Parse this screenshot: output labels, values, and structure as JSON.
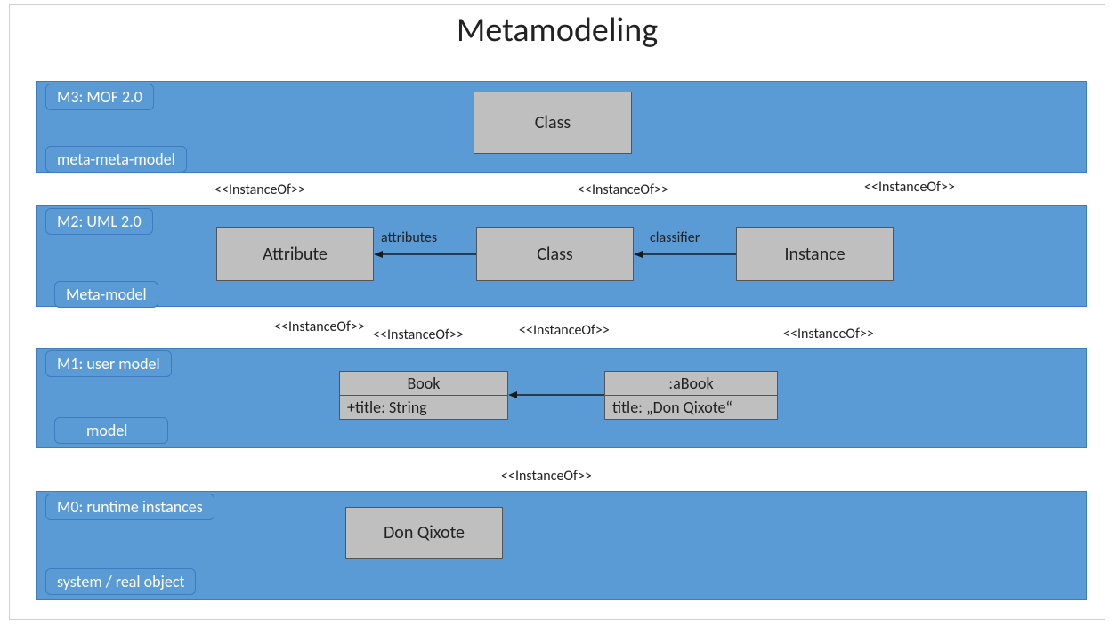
{
  "title": "Metamodeling",
  "stereotype": "<<InstanceOf>>",
  "layers": {
    "m3": {
      "name": "M3: MOF 2.0",
      "desc": "meta-meta-model"
    },
    "m2": {
      "name": "M2: UML 2.0",
      "desc": "Meta-model"
    },
    "m1": {
      "name": "M1: user model",
      "desc": "model"
    },
    "m0": {
      "name": "M0: runtime instances",
      "desc": "system / real object"
    }
  },
  "boxes": {
    "m3_class": "Class",
    "m2_attribute": "Attribute",
    "m2_class": "Class",
    "m2_instance": "Instance",
    "m1_book_title": "Book",
    "m1_book_attr": "+title: String",
    "m1_abook_title": ":aBook",
    "m1_abook_attr": "title: „Don Qixote“",
    "m0_obj": "Don Qixote"
  },
  "arrows": {
    "attributes": "attributes",
    "classifier": "classifier"
  }
}
